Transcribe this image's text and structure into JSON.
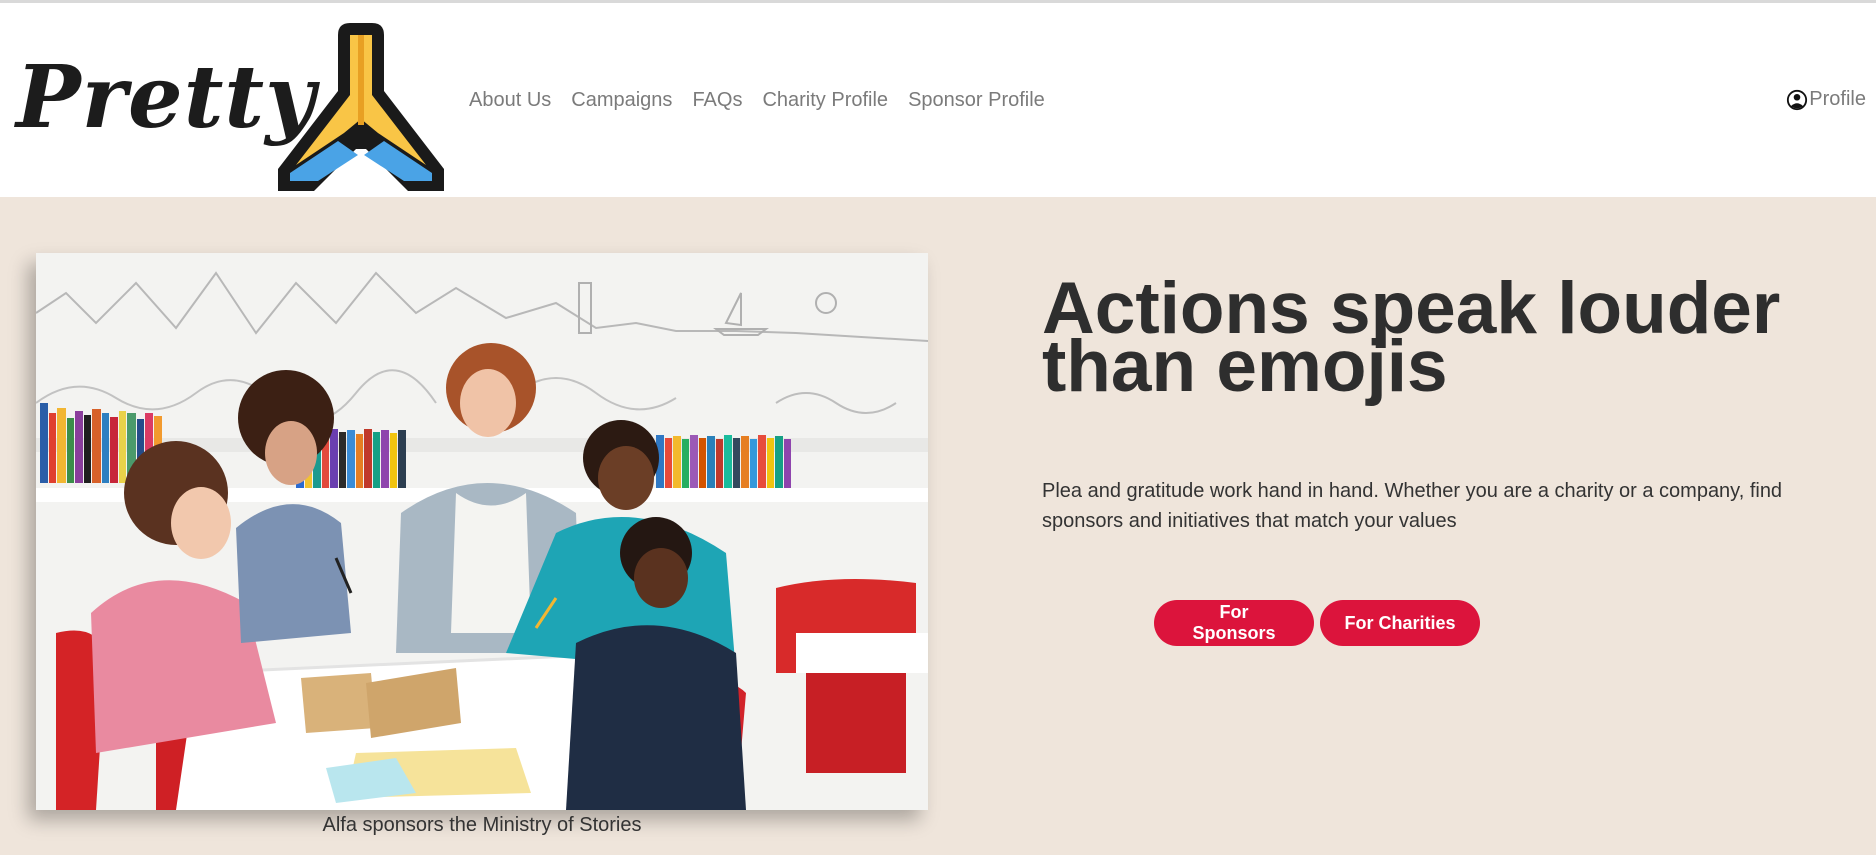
{
  "brand": {
    "name": "Pretty",
    "logo_icon": "praying-hands-icon"
  },
  "nav": {
    "items": [
      {
        "label": "About Us"
      },
      {
        "label": "Campaigns"
      },
      {
        "label": "FAQs"
      },
      {
        "label": "Charity Profile"
      },
      {
        "label": "Sponsor Profile"
      }
    ],
    "profile": {
      "label": "Profile",
      "icon": "user-circle-icon"
    }
  },
  "hero": {
    "headline": "Actions speak louder than emojis",
    "description": "Plea and gratitude work hand in hand. Whether you are a charity or a company, find sponsors and initiatives that match your values",
    "buttons": {
      "sponsors": "For Sponsors",
      "charities": "For Charities"
    },
    "image_caption": "Alfa sponsors the Ministry of Stories"
  },
  "colors": {
    "accent": "#dc143c",
    "hero_background": "#efe5db",
    "nav_text": "#7b7b7b",
    "headline": "#2e2e2e",
    "logo_yellow": "#f9c546",
    "logo_blue": "#4aa3e6"
  }
}
